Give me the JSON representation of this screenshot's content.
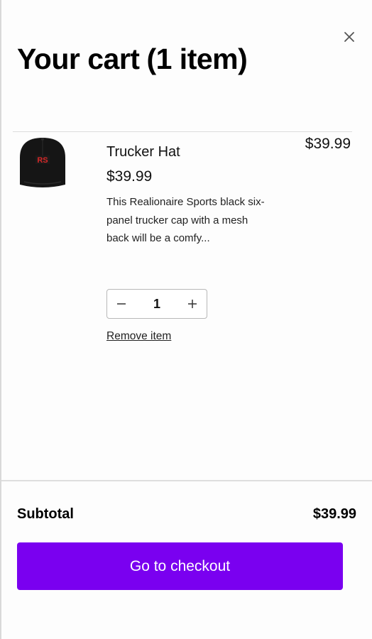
{
  "cart": {
    "title": "Your cart",
    "item_count_label": "(1 item)"
  },
  "close": {
    "icon": "close-icon"
  },
  "line_item": {
    "name": "Trucker Hat",
    "unit_price": "$39.99",
    "line_total": "$39.99",
    "description": "This Realionaire Sports black six-panel trucker cap with a mesh back will be a comfy...",
    "image_logo_text": "RS",
    "quantity": "1",
    "decrease_icon": "minus-icon",
    "increase_icon": "plus-icon",
    "remove_label": "Remove item"
  },
  "summary": {
    "subtotal_label": "Subtotal",
    "subtotal_value": "$39.99"
  },
  "checkout": {
    "label": "Go to checkout",
    "color": "#7a00f0"
  }
}
